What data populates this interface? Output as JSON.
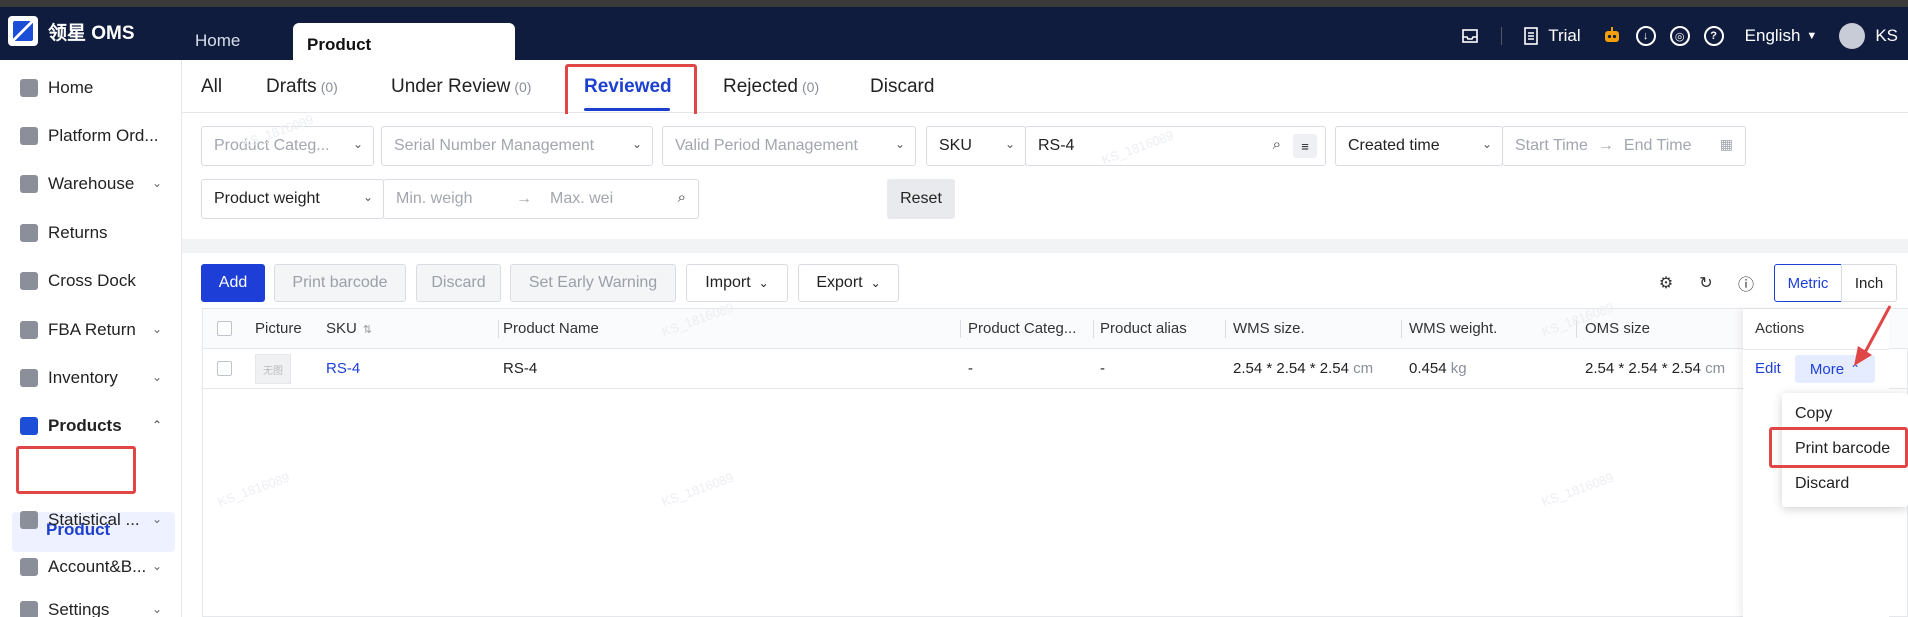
{
  "app": {
    "name": "领星 OMS"
  },
  "top_tabs": [
    {
      "label": "Home"
    },
    {
      "label": "Product"
    }
  ],
  "top_right": {
    "trial": "Trial",
    "language": "English",
    "user": "KS"
  },
  "sidebar": {
    "items": [
      {
        "label": "Home"
      },
      {
        "label": "Platform Ord..."
      },
      {
        "label": "Warehouse"
      },
      {
        "label": "Returns"
      },
      {
        "label": "Cross Dock"
      },
      {
        "label": "FBA Return"
      },
      {
        "label": "Inventory"
      },
      {
        "label": "Products"
      },
      {
        "label": "Statistical ..."
      },
      {
        "label": "Account&B..."
      },
      {
        "label": "Settings"
      }
    ],
    "sub_item": "Product"
  },
  "status_tabs": [
    {
      "label": "All",
      "count": ""
    },
    {
      "label": "Drafts",
      "count": "(0)"
    },
    {
      "label": "Under Review",
      "count": "(0)"
    },
    {
      "label": "Reviewed",
      "count": ""
    },
    {
      "label": "Rejected",
      "count": "(0)"
    },
    {
      "label": "Discard",
      "count": ""
    }
  ],
  "filters": {
    "product_category": "Product Categ...",
    "serial_number": "Serial Number Management",
    "valid_period": "Valid Period Management",
    "sku_type": "SKU",
    "sku_value": "RS-4",
    "time_type": "Created time",
    "start_time": "Start Time",
    "end_time": "End Time",
    "weight_type": "Product weight",
    "min_weight": "Min. weigh",
    "max_weight": "Max. wei",
    "reset": "Reset"
  },
  "toolbar": {
    "add": "Add",
    "print_barcode": "Print barcode",
    "discard": "Discard",
    "set_early_warning": "Set Early Warning",
    "import": "Import",
    "export": "Export",
    "metric": "Metric",
    "inch": "Inch"
  },
  "table": {
    "headers": {
      "picture": "Picture",
      "sku": "SKU",
      "product_name": "Product Name",
      "product_category": "Product Categ...",
      "product_alias": "Product alias",
      "wms_size": "WMS size.",
      "wms_weight": "WMS weight.",
      "oms_size": "OMS size",
      "actions": "Actions"
    },
    "rows": [
      {
        "thumb": "无图",
        "sku": "RS-4",
        "product_name": "RS-4",
        "product_category": "-",
        "product_alias": "-",
        "wms_size": "2.54 * 2.54 * 2.54",
        "wms_size_unit": "cm",
        "wms_weight": "0.454",
        "wms_weight_unit": "kg",
        "oms_size": "2.54 * 2.54 * 2.54",
        "oms_size_unit": "cm",
        "edit": "Edit",
        "more": "More"
      }
    ]
  },
  "more_menu": [
    {
      "label": "Copy"
    },
    {
      "label": "Print barcode"
    },
    {
      "label": "Discard"
    }
  ],
  "watermark": "KS_1816089",
  "colors": {
    "primary": "#1d3fd8",
    "topbar": "#0f1c3d",
    "highlight": "#e04646"
  }
}
